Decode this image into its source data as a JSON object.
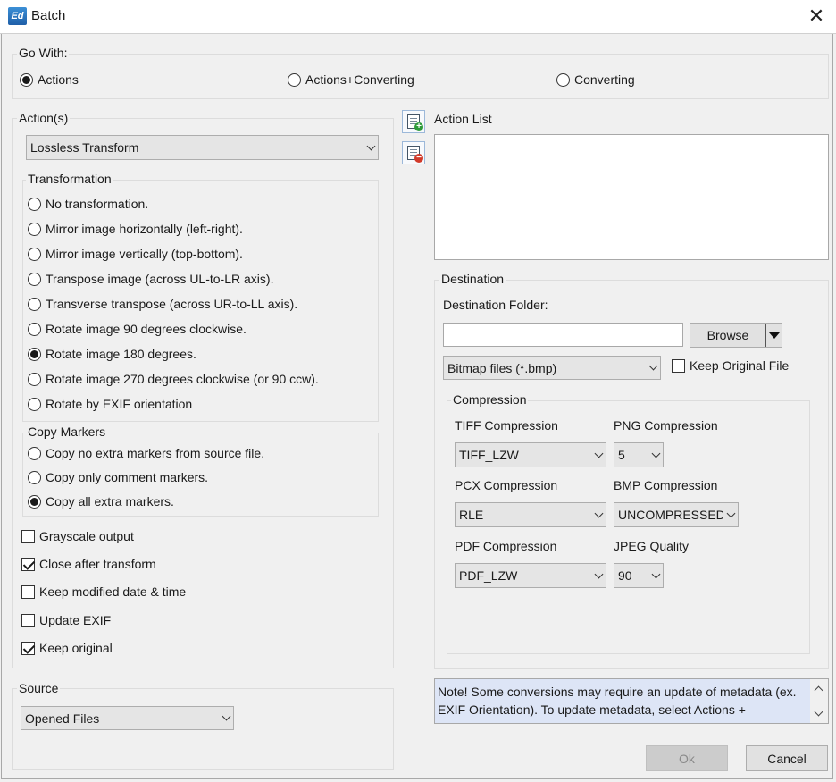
{
  "window": {
    "title": "Batch",
    "app_icon_text": "Ed",
    "close_glyph": "✕"
  },
  "go_with": {
    "label": "Go With:",
    "options": [
      {
        "label": "Actions",
        "selected": true
      },
      {
        "label": "Actions+Converting",
        "selected": false
      },
      {
        "label": "Converting",
        "selected": false
      }
    ]
  },
  "actions": {
    "label": "Action(s)",
    "selected_action": "Lossless Transform",
    "transformation": {
      "label": "Transformation",
      "options": [
        {
          "label": "No transformation.",
          "selected": false
        },
        {
          "label": "Mirror image horizontally (left-right).",
          "selected": false
        },
        {
          "label": "Mirror image vertically (top-bottom).",
          "selected": false
        },
        {
          "label": "Transpose image (across UL-to-LR axis).",
          "selected": false
        },
        {
          "label": "Transverse transpose (across UR-to-LL axis).",
          "selected": false
        },
        {
          "label": "Rotate image 90 degrees clockwise.",
          "selected": false
        },
        {
          "label": "Rotate image 180 degrees.",
          "selected": true
        },
        {
          "label": "Rotate image 270 degrees clockwise (or 90 ccw).",
          "selected": false
        },
        {
          "label": "Rotate by EXIF orientation",
          "selected": false
        }
      ]
    },
    "copy_markers": {
      "label": "Copy Markers",
      "options": [
        {
          "label": "Copy no extra markers from source file.",
          "selected": false
        },
        {
          "label": "Copy only comment markers.",
          "selected": false
        },
        {
          "label": "Copy all extra markers.",
          "selected": true
        }
      ]
    },
    "checkboxes": [
      {
        "label": "Grayscale output",
        "checked": false
      },
      {
        "label": "Close after transform",
        "checked": true
      },
      {
        "label": "Keep modified date & time",
        "checked": false
      },
      {
        "label": "Update EXIF",
        "checked": false
      },
      {
        "label": "Keep original",
        "checked": true
      }
    ]
  },
  "source": {
    "label": "Source",
    "selected": "Opened Files"
  },
  "action_list": {
    "label": "Action List",
    "add_icon": "add-action-icon",
    "remove_icon": "remove-action-icon"
  },
  "destination": {
    "label": "Destination",
    "folder_label": "Destination Folder:",
    "folder_value": "",
    "browse_label": "Browse",
    "file_type": "Bitmap files (*.bmp)",
    "keep_original_label": "Keep Original File",
    "keep_original_checked": false,
    "compression": {
      "label": "Compression",
      "tiff_label": "TIFF Compression",
      "tiff_value": "TIFF_LZW",
      "png_label": "PNG Compression",
      "png_value": "5",
      "pcx_label": "PCX Compression",
      "pcx_value": "RLE",
      "bmp_label": "BMP Compression",
      "bmp_value": "UNCOMPRESSED",
      "pdf_label": "PDF Compression",
      "pdf_value": "PDF_LZW",
      "jpeg_label": "JPEG Quality",
      "jpeg_value": "90"
    }
  },
  "note": "Note! Some conversions may require an update of metadata (ex. EXIF Orientation). To update metadata, select Actions + Converting and check Update EXIF in the Actions section.",
  "buttons": {
    "ok": "Ok",
    "cancel": "Cancel"
  },
  "colors": {
    "note_bg": "#dde5f6",
    "dialog_bg": "#f0f0f0",
    "accent": "#1f5fa8"
  }
}
